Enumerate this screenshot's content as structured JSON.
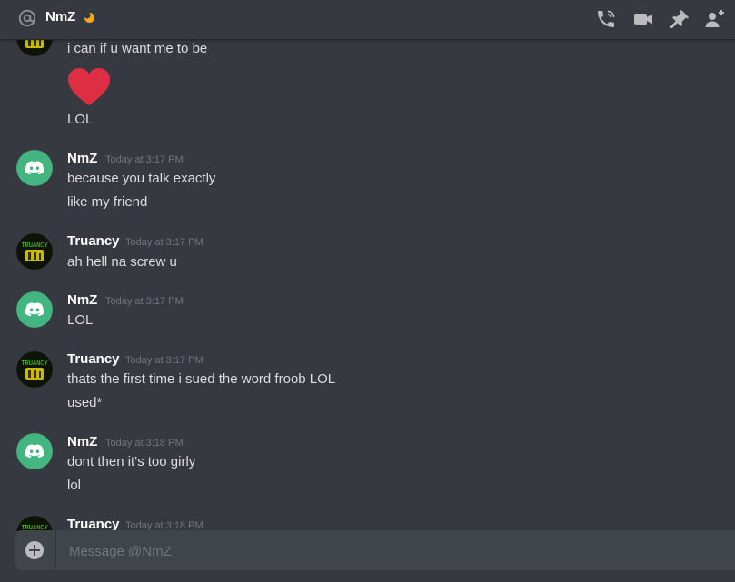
{
  "header": {
    "title": "NmZ",
    "status": "idle",
    "icons": [
      "at-icon",
      "moon-icon",
      "call-icon",
      "video-icon",
      "pin-icon",
      "add-member-icon"
    ]
  },
  "colors": {
    "background": "#36393f",
    "composer": "#40444b",
    "discord_green": "#43b581",
    "idle": "#faa61a",
    "heart": "#dd2e44"
  },
  "messages": [
    {
      "author": "",
      "avatar": "truancy-avatar",
      "lines": [
        "i can if u want me to be"
      ],
      "emoji": "heart-emoji",
      "extra_lines": [
        "LOL"
      ]
    },
    {
      "author": "NmZ",
      "time": "Today at 3:17 PM",
      "avatar": "discord-avatar",
      "lines": [
        "because you talk exactly",
        "like my friend"
      ]
    },
    {
      "author": "Truancy",
      "time": "Today at 3:17 PM",
      "avatar": "truancy-avatar",
      "lines": [
        "ah hell na screw u"
      ]
    },
    {
      "author": "NmZ",
      "time": "Today at 3:17 PM",
      "avatar": "discord-avatar",
      "lines": [
        "LOL"
      ]
    },
    {
      "author": "Truancy",
      "time": "Today at 3:17 PM",
      "avatar": "truancy-avatar",
      "lines": [
        "thats the first time i sued the word froob LOL",
        "used*"
      ]
    },
    {
      "author": "NmZ",
      "time": "Today at 3:18 PM",
      "avatar": "discord-avatar",
      "lines": [
        "dont then it's too girly",
        "lol"
      ]
    },
    {
      "author": "Truancy",
      "time": "Today at 3:18 PM",
      "avatar": "truancy-avatar",
      "lines": []
    }
  ],
  "composer": {
    "placeholder": "Message @NmZ"
  }
}
